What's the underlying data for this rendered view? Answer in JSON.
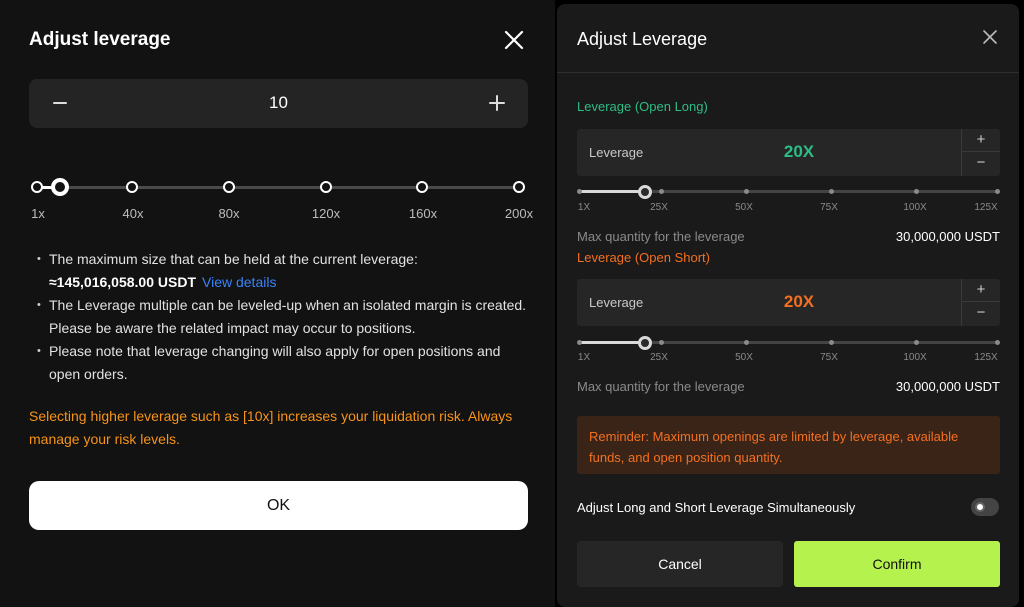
{
  "left_modal": {
    "title": "Adjust leverage",
    "stepper": {
      "minus": "−",
      "plus": "+",
      "value": "10"
    },
    "ticks": [
      "1x",
      "40x",
      "80x",
      "120x",
      "160x",
      "200x"
    ],
    "info": {
      "item1": "The maximum size that can be held at the current leverage:",
      "amount": "≈145,016,058.00 USDT",
      "view_details": "View details",
      "item2": "The Leverage multiple can be leveled-up when an isolated margin is created. Please be aware the related impact may occur to positions.",
      "item3": "Please note that leverage changing will also apply for open positions and open orders."
    },
    "warning": "Selecting higher leverage such as [10x] increases your liquidation risk. Always manage your risk levels.",
    "ok_label": "OK"
  },
  "right_modal": {
    "title": "Adjust Leverage",
    "long": {
      "section_label": "Leverage (Open Long)",
      "input_label": "Leverage",
      "value": "20X",
      "max_label": "Max quantity for the leverage",
      "max_value": "30,000,000 USDT"
    },
    "short": {
      "section_label": "Leverage (Open Short)",
      "input_label": "Leverage",
      "value": "20X",
      "max_label": "Max quantity for the leverage",
      "max_value": "30,000,000 USDT"
    },
    "stepper_plus": "+",
    "stepper_minus": "−",
    "ticks": [
      "1X",
      "25X",
      "50X",
      "75X",
      "100X",
      "125X"
    ],
    "reminder": "Reminder: Maximum openings are limited by leverage, available funds, and open position quantity.",
    "simultaneous_label": "Adjust Long and Short Leverage Simultaneously",
    "cancel_label": "Cancel",
    "confirm_label": "Confirm"
  },
  "colors": {
    "long_green": "#2ebd85",
    "short_orange": "#f37021",
    "warning_orange": "#f7931a",
    "link_blue": "#3b82f6",
    "confirm_lime": "#b5f24e"
  }
}
